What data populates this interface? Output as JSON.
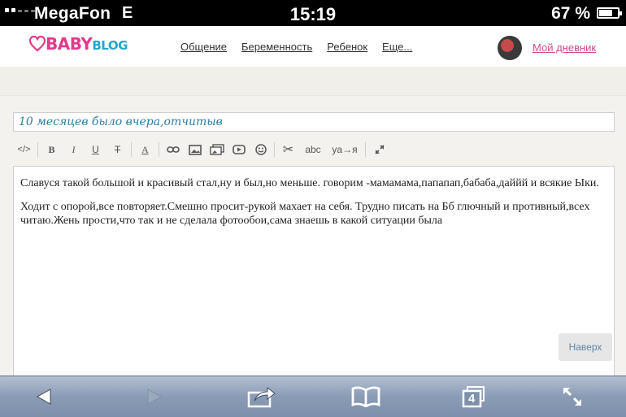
{
  "status_bar": {
    "carrier": "MegaFon",
    "network": "E",
    "time": "15:19",
    "battery": "67 %",
    "battery_level": 0.67
  },
  "header": {
    "logo_text_main": "BABY",
    "logo_text_sub": "BLOG",
    "nav": [
      "Общение",
      "Беременность",
      "Ребенок",
      "Еще..."
    ],
    "my_diary": "Мой дневник"
  },
  "editor": {
    "title_value": "10 месяцев было вчера,отчитыв",
    "toolbar": [
      {
        "label": "</>",
        "icon": "code-icon"
      },
      {
        "label": "B",
        "icon": "bold-icon"
      },
      {
        "label": "I",
        "icon": "italic-icon"
      },
      {
        "label": "U",
        "icon": "underline-icon"
      },
      {
        "label": "T",
        "icon": "strikethrough-icon"
      },
      {
        "label": "A",
        "icon": "text-color-icon"
      },
      {
        "label": "",
        "icon": "link-icon"
      },
      {
        "label": "",
        "icon": "image-icon"
      },
      {
        "label": "",
        "icon": "gallery-icon"
      },
      {
        "label": "",
        "icon": "video-icon"
      },
      {
        "label": "",
        "icon": "smiley-icon"
      },
      {
        "label": "",
        "icon": "cut-icon"
      },
      {
        "label": "abc",
        "icon": "spellcheck-icon"
      },
      {
        "label": "ya→я",
        "icon": "transliterate-icon"
      },
      {
        "label": "",
        "icon": "fullscreen-icon"
      }
    ],
    "paragraphs": [
      "Славуся такой большой и красивый стал,ну и был,но меньше. говорим -мамамама,папапап,бабаба,даййй и всякие Ыки.",
      "Ходит с опорой,все повторяет.Смешно просит-рукой махает на себя. Трудно писать на Бб глючный и противный,всех читаю.Жень прости,что так и не сделала фотообои,сама знаешь в какой ситуации была"
    ],
    "up_button": "Наверх"
  },
  "safari": {
    "tabs_count": "4"
  },
  "colors": {
    "logo_pink": "#e33a8a",
    "logo_blue": "#23a6cf",
    "link_pink": "#d14b8f",
    "title_blue": "#2c7ea3"
  }
}
